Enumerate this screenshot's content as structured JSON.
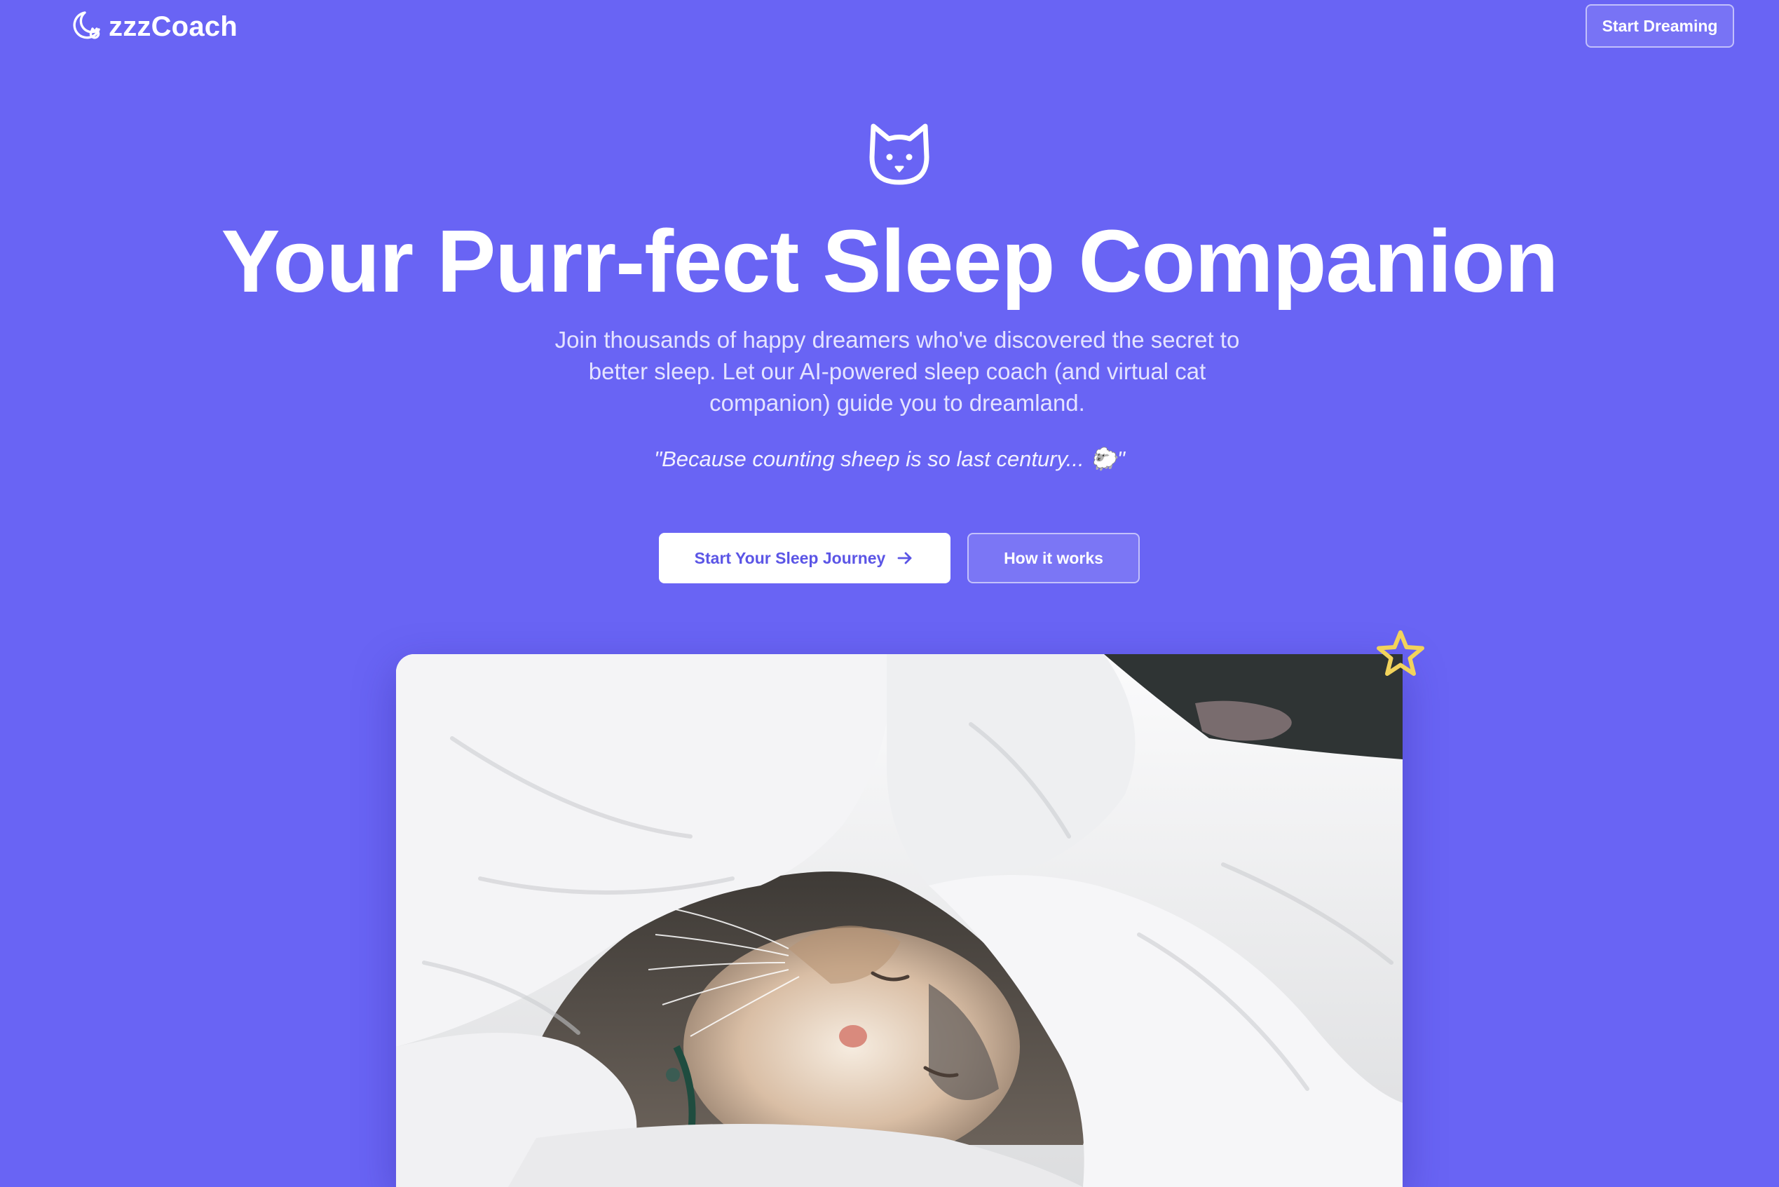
{
  "nav": {
    "brand_name": "zzzCoach",
    "brand_icon": "moon-cat-icon",
    "cta_label": "Start Dreaming"
  },
  "hero": {
    "icon": "cat-face-icon",
    "title": "Your Purr-fect Sleep Companion",
    "subtitle": "Join thousands of happy dreamers who've discovered the secret to better sleep. Let our AI-powered sleep coach (and virtual cat companion) guide you to dreamland.",
    "quote": "\"Because counting sheep is so last century... 🐑\"",
    "primary_button": {
      "label": "Start Your Sleep Journey",
      "icon": "arrow-right-icon"
    },
    "secondary_button": {
      "label": "How it works"
    }
  },
  "showcase": {
    "image": "sleeping-cat-under-blanket-photo",
    "decoration_icon": "star-icon"
  },
  "colors": {
    "background": "#6964f4",
    "primary_text_on_white": "#5b55e6",
    "star": "#f2d35b"
  }
}
